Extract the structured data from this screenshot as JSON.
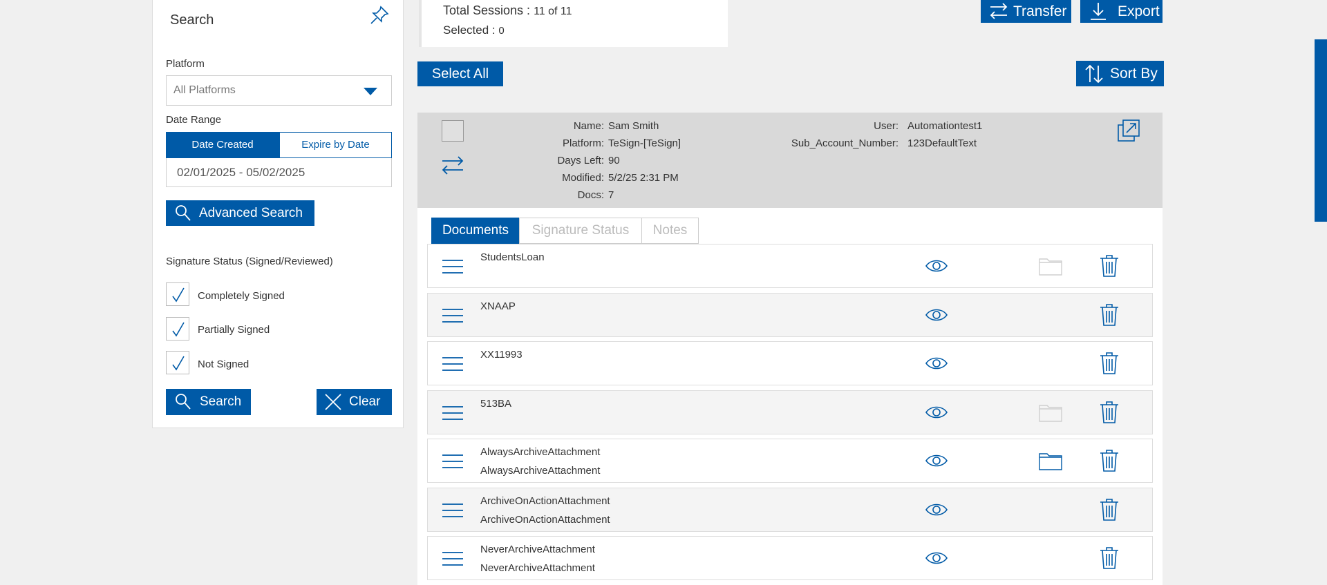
{
  "left_panel": {
    "title": "Search",
    "platform_label": "Platform",
    "platform_value": "All Platforms",
    "date_range_label": "Date Range",
    "date_tabs": [
      "Date Created",
      "Expire by Date"
    ],
    "date_range_value": "02/01/2025 - 05/02/2025",
    "advanced_search_label": "Advanced Search",
    "signature_status_label": "Signature Status (Signed/Reviewed)",
    "checkboxes": [
      {
        "label": "Completely Signed",
        "checked": true
      },
      {
        "label": "Partially Signed",
        "checked": true
      },
      {
        "label": "Not Signed",
        "checked": true
      }
    ],
    "search_label": "Search",
    "clear_label": "Clear"
  },
  "summary": {
    "total_sessions_label": "Total Sessions :",
    "total_sessions_value": "11 of 11",
    "selected_label": "Selected :",
    "selected_value": "0"
  },
  "toolbar": {
    "transfer_label": "Transfer",
    "export_label": "Export",
    "select_all_label": "Select All",
    "sort_by_label": "Sort By"
  },
  "session": {
    "name_key": "Name:",
    "name_value": "Sam Smith",
    "platform_key": "Platform:",
    "platform_value": "TeSign-[TeSign]",
    "days_left_key": "Days Left:",
    "days_left_value": "90",
    "modified_key": "Modified:",
    "modified_value": "5/2/25 2:31 PM",
    "docs_key": "Docs:",
    "docs_value": "7",
    "user_key": "User:",
    "user_value": "Automationtest1",
    "sub_account_key": "Sub_Account_Number:",
    "sub_account_value": "123DefaultText",
    "tabs": [
      "Documents",
      "Signature Status",
      "Notes"
    ],
    "documents": [
      {
        "name": "StudentsLoan",
        "sub": "",
        "folder": "light"
      },
      {
        "name": "XNAAP",
        "sub": "",
        "folder": "none"
      },
      {
        "name": "XX11993",
        "sub": "",
        "folder": "none"
      },
      {
        "name": "513BA",
        "sub": "",
        "folder": "light"
      },
      {
        "name": "AlwaysArchiveAttachment",
        "sub": "AlwaysArchiveAttachment",
        "folder": "dark"
      },
      {
        "name": "ArchiveOnActionAttachment",
        "sub": "ArchiveOnActionAttachment",
        "folder": "none"
      },
      {
        "name": "NeverArchiveAttachment",
        "sub": "NeverArchiveAttachment",
        "folder": "none"
      }
    ]
  },
  "colors": {
    "accent": "#005aa7",
    "header_bg": "#d9d9d9",
    "page_bg": "#f0f0f0"
  }
}
